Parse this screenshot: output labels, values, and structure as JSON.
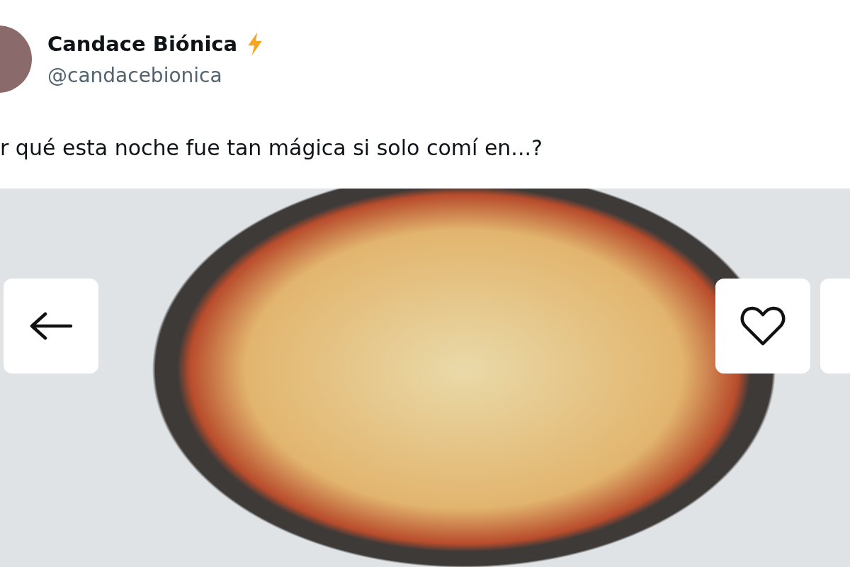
{
  "author": {
    "name": "Candace Biónica",
    "handle": "@candacebionica"
  },
  "tweet": {
    "text": "r qué esta noche fue tan mágica si solo comí en...?"
  }
}
